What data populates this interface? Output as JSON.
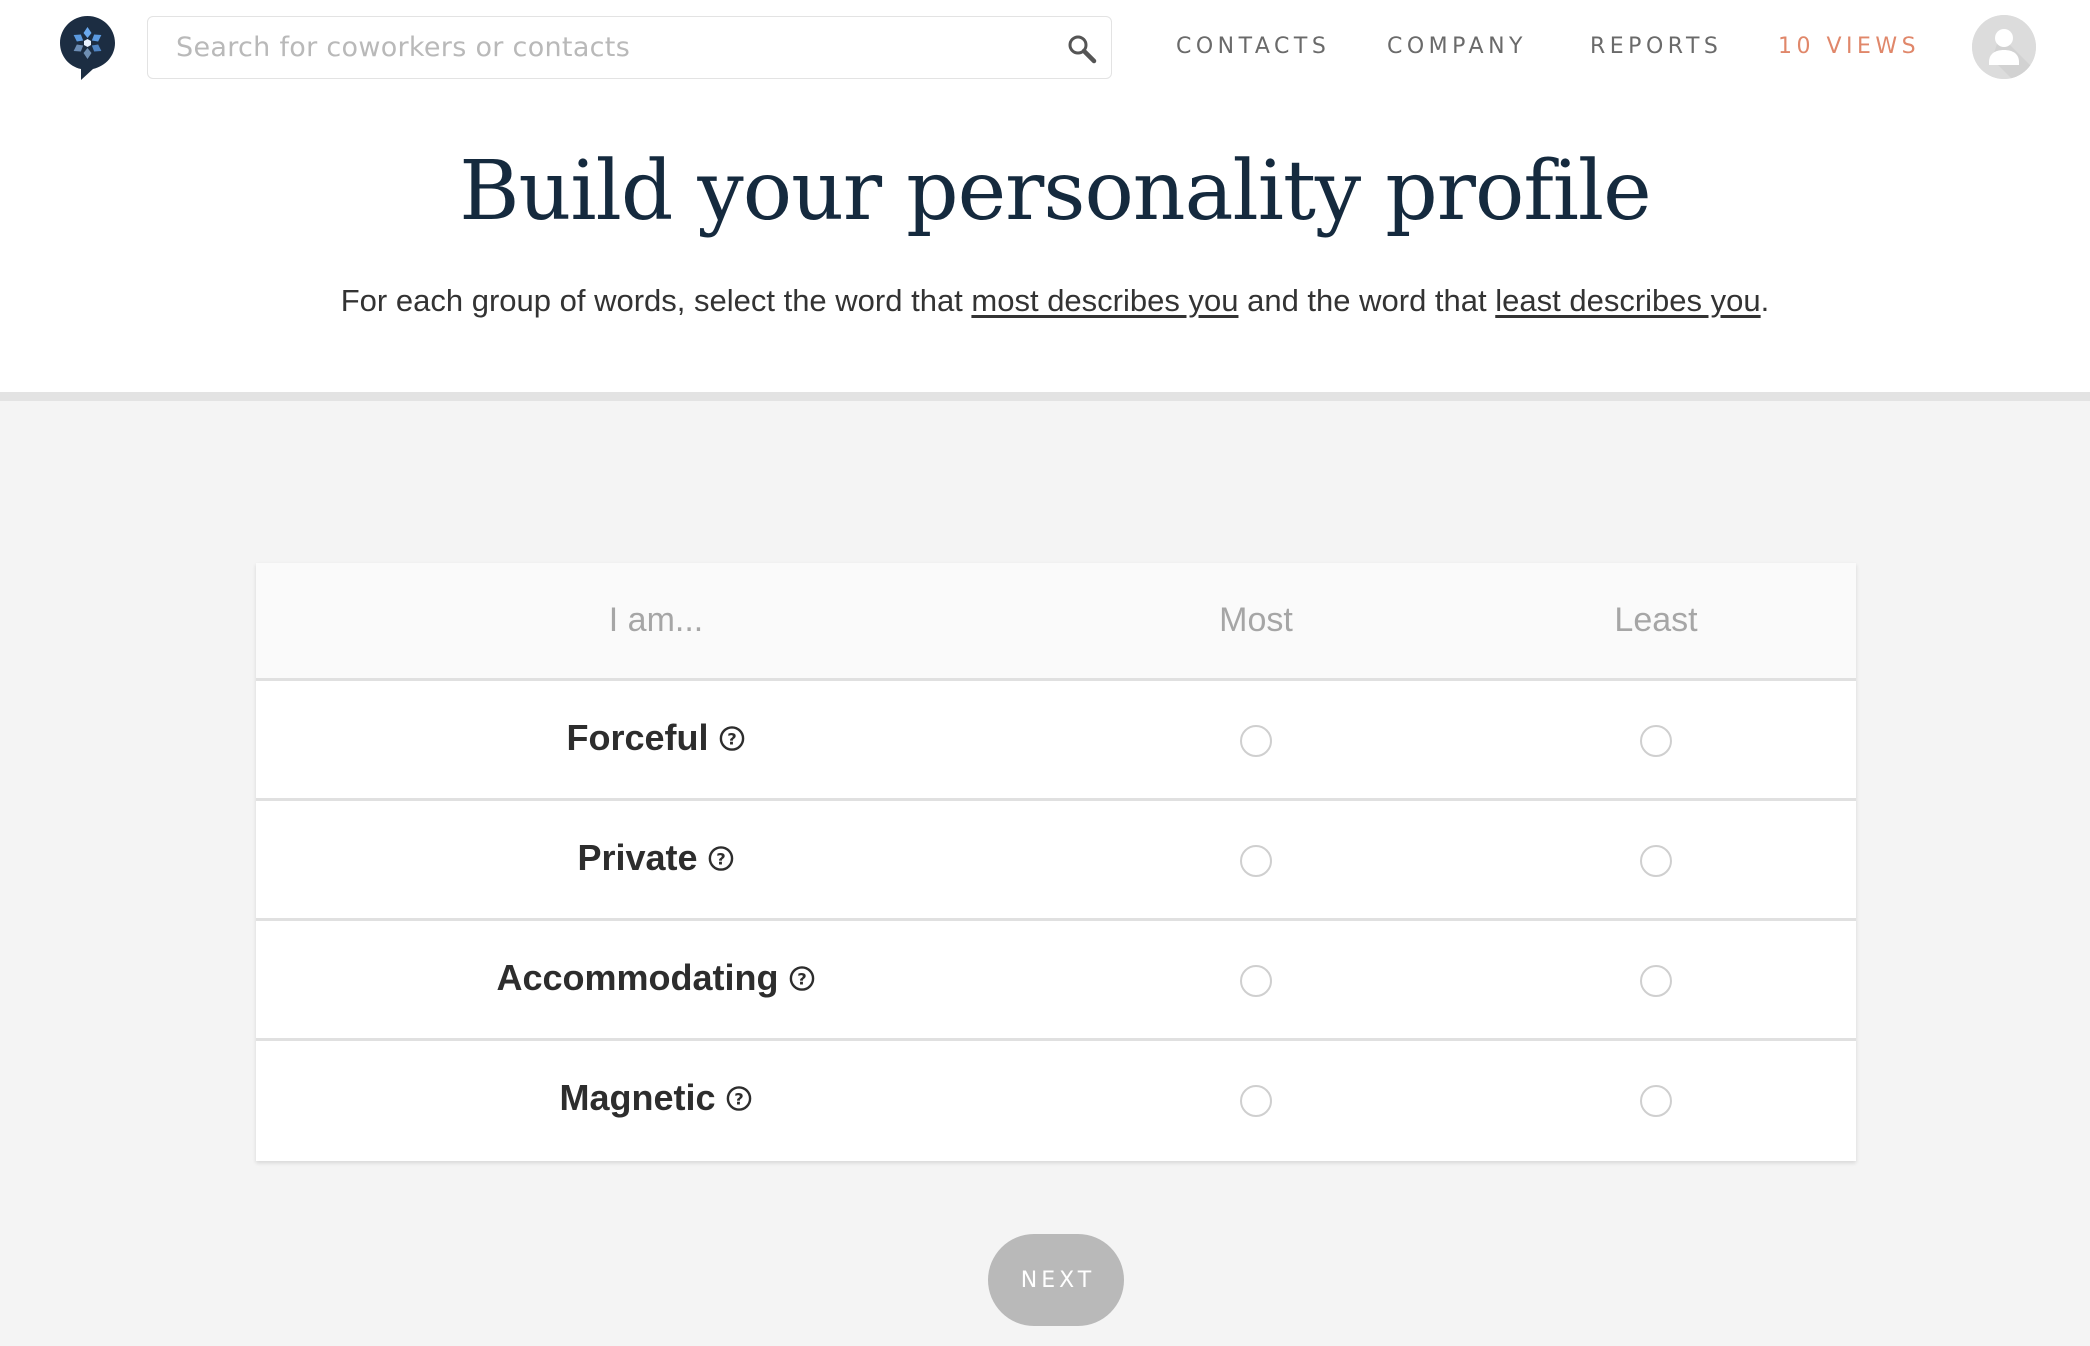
{
  "header": {
    "logo_icon": "speech-bubble-flower-logo-icon",
    "search": {
      "placeholder": "Search for coworkers or contacts",
      "value": "",
      "icon": "search-icon"
    },
    "nav": [
      {
        "label": "CONTACTS"
      },
      {
        "label": "COMPANY"
      },
      {
        "label": "REPORTS"
      },
      {
        "label": "10 VIEWS",
        "color": "#e0876a"
      }
    ],
    "avatar_icon": "user-avatar-icon"
  },
  "hero": {
    "title": "Build your personality profile",
    "subtitle_part1": "For each group of words, select the word that ",
    "subtitle_link1": "most describes you",
    "subtitle_part2": " and the word that ",
    "subtitle_link2": "least describes you",
    "subtitle_part3": "."
  },
  "table": {
    "headers": {
      "word": "I am...",
      "most": "Most",
      "least": "Least"
    },
    "rows": [
      {
        "word": "Forceful",
        "most_selected": false,
        "least_selected": false
      },
      {
        "word": "Private",
        "most_selected": false,
        "least_selected": false
      },
      {
        "word": "Accommodating",
        "most_selected": false,
        "least_selected": false
      },
      {
        "word": "Magnetic",
        "most_selected": false,
        "least_selected": false
      }
    ]
  },
  "actions": {
    "next_label": "NEXT",
    "next_enabled": false
  },
  "colors": {
    "title": "#152a3e",
    "accent_views": "#e0876a",
    "button_disabled": "#b9b9b9",
    "logo_bg": "#1c2d42",
    "logo_petals": "#5b9ae0"
  }
}
